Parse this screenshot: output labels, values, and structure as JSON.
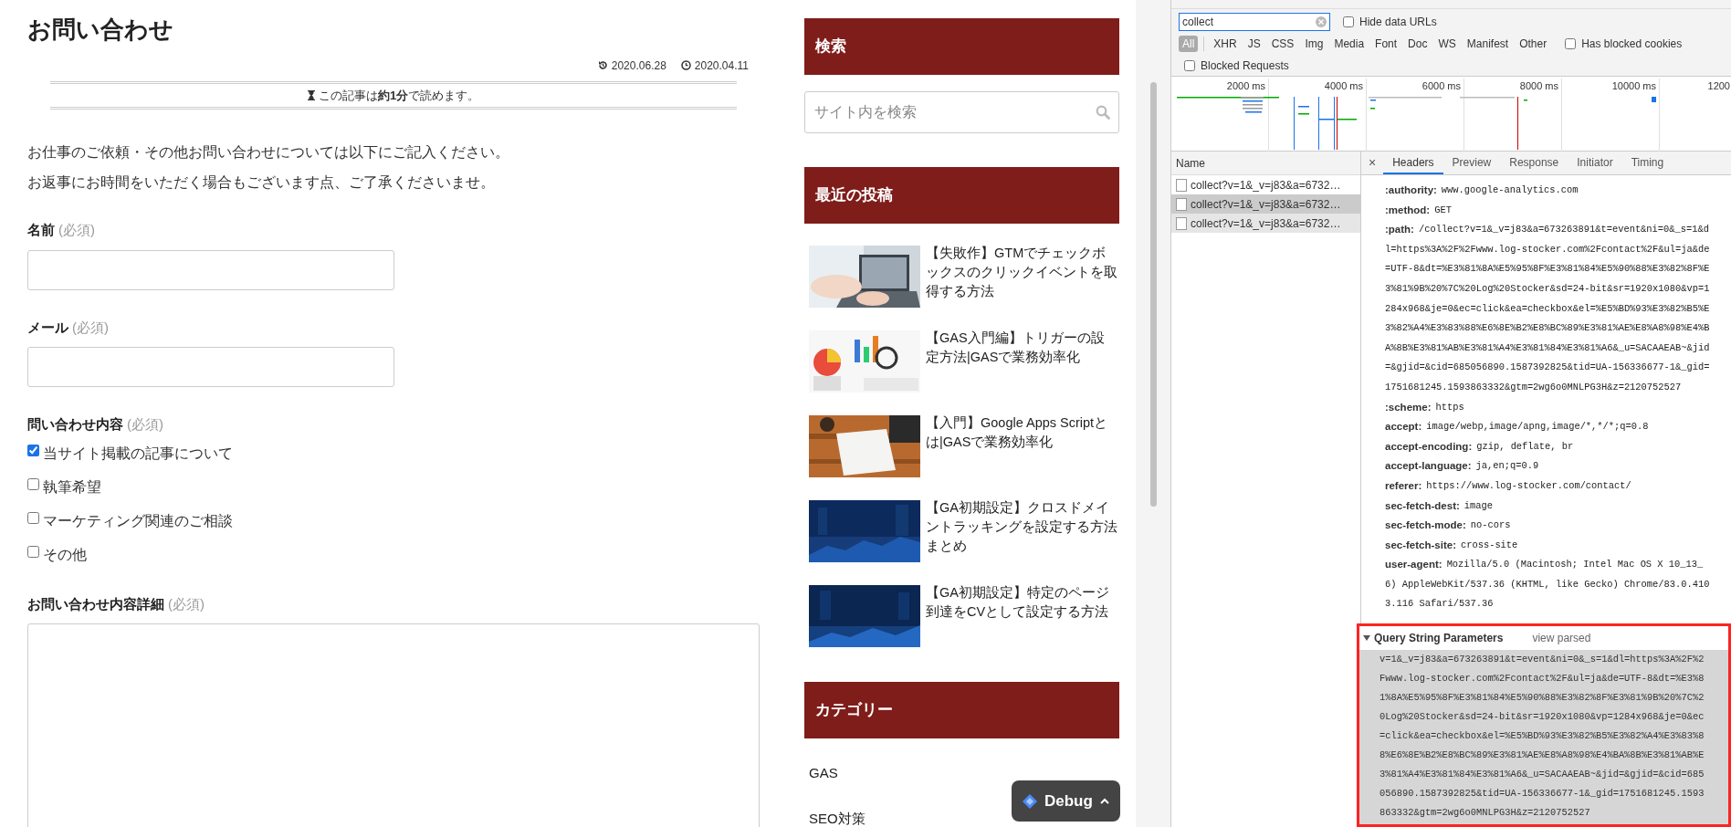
{
  "article": {
    "title": "お問い合わせ",
    "dates": [
      {
        "kind": "updated",
        "text": "2020.06.28"
      },
      {
        "kind": "published",
        "text": "2020.04.11"
      }
    ],
    "reading_time": "この記事は**約1分**で読めます。",
    "intro": [
      "お仕事のご依頼・その他お問い合わせについては以下にご記入ください。",
      "お返事にお時間をいただく場合もございます点、ご了承くださいませ。"
    ],
    "form": [
      {
        "kind": "text",
        "label": "名前",
        "required": "(必須)"
      },
      {
        "kind": "text",
        "label": "メール",
        "required": "(必須)"
      },
      {
        "kind": "checkboxes",
        "label": "問い合わせ内容",
        "required": "(必須)",
        "options": [
          {
            "label": "当サイト掲載の記事について",
            "checked": true
          },
          {
            "label": "執筆希望",
            "checked": false
          },
          {
            "label": "マーケティング関連のご相談",
            "checked": false
          },
          {
            "label": "その他",
            "checked": false
          }
        ]
      },
      {
        "kind": "textarea",
        "label": "お問い合わせ内容詳細",
        "required": "(必須)"
      }
    ]
  },
  "sidebar": {
    "search": {
      "heading": "検索",
      "placeholder": "サイト内を検索"
    },
    "recent": {
      "heading": "最近の投稿",
      "posts": [
        {
          "title": "【失敗作】GTMでチェックボックスのクリックイベントを取得する方法"
        },
        {
          "title": "【GAS入門編】トリガーの設定方法|GASで業務効率化"
        },
        {
          "title": "【入門】Google Apps Scriptとは|GASで業務効率化"
        },
        {
          "title": "【GA初期設定】クロスドメイントラッキングを設定する方法まとめ"
        },
        {
          "title": "【GA初期設定】特定のページ到達をCVとして設定する方法"
        }
      ]
    },
    "categories": {
      "heading": "カテゴリー",
      "items": [
        "GAS",
        "SEO対策"
      ]
    }
  },
  "debug_button": "Debug",
  "devtools": {
    "filter": {
      "value": "collect"
    },
    "hide_data_urls": {
      "label": "Hide data URLs",
      "checked": false
    },
    "types": [
      {
        "label": "All",
        "selected": true
      },
      {
        "label": "XHR",
        "selected": false
      },
      {
        "label": "JS",
        "selected": false
      },
      {
        "label": "CSS",
        "selected": false
      },
      {
        "label": "Img",
        "selected": false
      },
      {
        "label": "Media",
        "selected": false
      },
      {
        "label": "Font",
        "selected": false
      },
      {
        "label": "Doc",
        "selected": false
      },
      {
        "label": "WS",
        "selected": false
      },
      {
        "label": "Manifest",
        "selected": false
      },
      {
        "label": "Other",
        "selected": false
      }
    ],
    "has_blocked_cookies": {
      "label": "Has blocked cookies",
      "checked": false
    },
    "blocked_requests": {
      "label": "Blocked Requests",
      "checked": false
    },
    "timeline": {
      "ticks": [
        "2000 ms",
        "4000 ms",
        "6000 ms",
        "8000 ms",
        "10000 ms",
        "1200"
      ]
    },
    "requests": {
      "column": "Name",
      "rows": [
        {
          "name": "collect?v=1&_v=j83&a=6732…",
          "selected": false,
          "hovered": false
        },
        {
          "name": "collect?v=1&_v=j83&a=6732…",
          "selected": true,
          "hovered": false
        },
        {
          "name": "collect?v=1&_v=j83&a=6732…",
          "selected": false,
          "hovered": true
        }
      ]
    },
    "close": "×",
    "tabs": [
      {
        "label": "Headers",
        "selected": true
      },
      {
        "label": "Preview",
        "selected": false
      },
      {
        "label": "Response",
        "selected": false
      },
      {
        "label": "Initiator",
        "selected": false
      },
      {
        "label": "Timing",
        "selected": false
      }
    ],
    "headers": [
      {
        "name": ":authority:",
        "lines": [
          "www.google-analytics.com"
        ]
      },
      {
        "name": ":method:",
        "lines": [
          "GET"
        ]
      },
      {
        "name": ":path:",
        "lines": [
          "/collect?v=1&_v=j83&a=673263891&t=event&ni=0&_s=1&d",
          "l=https%3A%2F%2Fwww.log-stocker.com%2Fcontact%2F&ul=ja&de",
          "=UTF-8&dt=%E3%81%8A%E5%95%8F%E3%81%84%E5%90%88%E3%82%8F%E",
          "3%81%9B%20%7C%20Log%20Stocker&sd=24-bit&sr=1920x1080&vp=1",
          "284x968&je=0&ec=click&ea=checkbox&el=%E5%BD%93%E3%82%B5%E",
          "3%82%A4%E3%83%88%E6%8E%B2%E8%BC%89%E3%81%AE%E8%A8%98%E4%B",
          "A%8B%E3%81%AB%E3%81%A4%E3%81%84%E3%81%A6&_u=SACAAEAB~&jid",
          "=&gjid=&cid=685056890.1587392825&tid=UA-156336677-1&_gid=",
          "1751681245.1593863332&gtm=2wg6o0MNLPG3H&z=2120752527"
        ]
      },
      {
        "name": ":scheme:",
        "lines": [
          "https"
        ]
      },
      {
        "name": "accept:",
        "lines": [
          "image/webp,image/apng,image/*,*/*;q=0.8"
        ]
      },
      {
        "name": "accept-encoding:",
        "lines": [
          "gzip, deflate, br"
        ]
      },
      {
        "name": "accept-language:",
        "lines": [
          "ja,en;q=0.9"
        ]
      },
      {
        "name": "referer:",
        "lines": [
          "https://www.log-stocker.com/contact/"
        ]
      },
      {
        "name": "sec-fetch-dest:",
        "lines": [
          "image"
        ]
      },
      {
        "name": "sec-fetch-mode:",
        "lines": [
          "no-cors"
        ]
      },
      {
        "name": "sec-fetch-site:",
        "lines": [
          "cross-site"
        ]
      },
      {
        "name": "user-agent:",
        "lines": [
          "Mozilla/5.0 (Macintosh; Intel Mac OS X 10_13_",
          "6) AppleWebKit/537.36 (KHTML, like Gecko) Chrome/83.0.410",
          "3.116 Safari/537.36"
        ]
      }
    ],
    "query_string": {
      "title": "Query String Parameters",
      "expanded": true,
      "toggle": "view parsed",
      "lines": [
        "v=1&_v=j83&a=673263891&t=event&ni=0&_s=1&dl=https%3A%2F%2",
        "Fwww.log-stocker.com%2Fcontact%2F&ul=ja&de=UTF-8&dt=%E3%8",
        "1%8A%E5%95%8F%E3%81%84%E5%90%88%E3%82%8F%E3%81%9B%20%7C%2",
        "0Log%20Stocker&sd=24-bit&sr=1920x1080&vp=1284x968&je=0&ec",
        "=click&ea=checkbox&el=%E5%BD%93%E3%82%B5%E3%82%A4%E3%83%8",
        "8%E6%8E%B2%E8%BC%89%E3%81%AE%E8%A8%98%E4%BA%8B%E3%81%AB%E",
        "3%81%A4%E3%81%84%E3%81%A6&_u=SACAAEAB~&jid=&gjid=&cid=685",
        "056890.1587392825&tid=UA-156336677-1&_gid=1751681245.1593",
        "863332&gtm=2wg6o0MNLPG3H&z=2120752527"
      ]
    }
  }
}
